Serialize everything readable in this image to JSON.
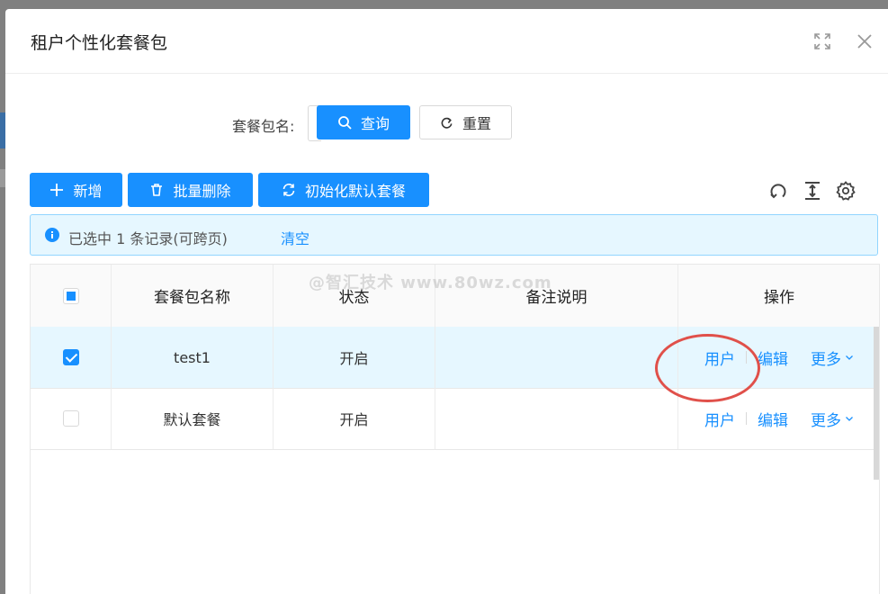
{
  "modal": {
    "title": "租户个性化套餐包"
  },
  "search": {
    "label": "套餐包名:",
    "query_label": "查询",
    "reset_label": "重置"
  },
  "toolbar": {
    "add_label": "新增",
    "batch_delete_label": "批量删除",
    "init_default_label": "初始化默认套餐"
  },
  "alert": {
    "text": "已选中 1 条记录(可跨页)",
    "clear_label": "清空"
  },
  "table": {
    "columns": [
      "套餐包名称",
      "状态",
      "备注说明",
      "操作"
    ],
    "rows": [
      {
        "name": "test1",
        "status": "开启",
        "remark": "",
        "selected": true
      },
      {
        "name": "默认套餐",
        "status": "开启",
        "remark": "",
        "selected": false
      }
    ],
    "actions": {
      "user": "用户",
      "edit": "编辑",
      "more": "更多"
    }
  },
  "watermark": "@智汇技术 www.80wz.com",
  "colors": {
    "primary": "#1890ff",
    "alert_bg": "#e6f7ff",
    "selected_row": "#e6f7ff",
    "annotation": "#e0504a"
  },
  "icons": [
    "search-icon",
    "reload-icon",
    "plus-icon",
    "trash-icon",
    "sync-icon",
    "refresh-icon",
    "column-height-icon",
    "gear-icon",
    "fullscreen-icon",
    "close-icon",
    "info-icon",
    "chevron-down-icon"
  ]
}
